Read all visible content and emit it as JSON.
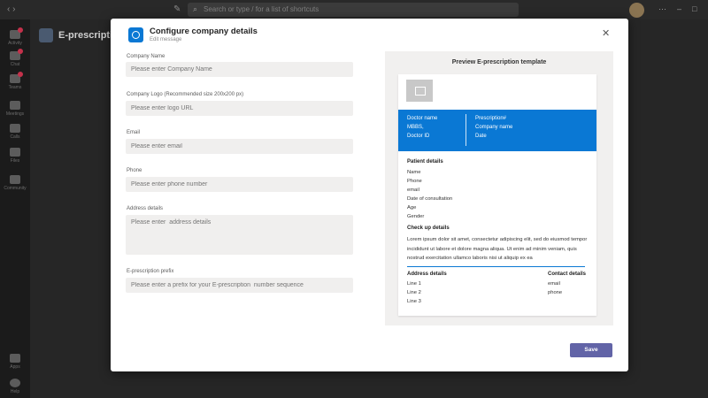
{
  "topbar": {
    "search_placeholder": "Search or type / for a list of shortcuts"
  },
  "rail": {
    "items": [
      {
        "label": "Activity",
        "icon": "bell-icon"
      },
      {
        "label": "Chat",
        "icon": "chat-icon"
      },
      {
        "label": "Teams",
        "icon": "teams-icon"
      },
      {
        "label": "Meetings",
        "icon": "calendar-icon"
      },
      {
        "label": "Calls",
        "icon": "phone-icon"
      },
      {
        "label": "Files",
        "icon": "file-icon"
      },
      {
        "label": "Community",
        "icon": "apps-icon"
      },
      {
        "label": "Apps",
        "icon": "grid-icon"
      },
      {
        "label": "Help",
        "icon": "help-icon"
      }
    ]
  },
  "app": {
    "title": "E-prescription"
  },
  "dialog": {
    "title": "Configure company details",
    "subtitle": "Edit message",
    "fields": {
      "company_name": {
        "label": "Company Name",
        "placeholder": "Please enter Company Name"
      },
      "company_logo": {
        "label": "Company Logo (Recommended size 200x200 px)",
        "placeholder": "Please enter logo URL"
      },
      "email": {
        "label": "Email",
        "placeholder": "Please enter email"
      },
      "phone": {
        "label": "Phone",
        "placeholder": "Please enter phone number"
      },
      "address": {
        "label": "Address details",
        "placeholder": "Please enter  address details"
      },
      "prefix": {
        "label": "E-prescription prefix",
        "placeholder": "Please enter a prefix for your E-prescription  number sequence"
      }
    },
    "save_label": "Save"
  },
  "preview": {
    "title": "Preview E-prescription template",
    "band_left": [
      "Doctor name",
      "MBBS,",
      "Doctor ID"
    ],
    "band_right": [
      "Prescription#",
      "Company name",
      "Date"
    ],
    "patient_heading": "Patient details",
    "patient_fields": [
      "Name",
      "Phone",
      "email",
      "Date of consultation",
      "Age",
      "Gender"
    ],
    "checkup_heading": "Check up details",
    "checkup_text": "Lorem ipsum dolor sit amet, consectetur adipiscing elit, sed do eiusmod tempor incididunt ut labore et dolore magna aliqua. Ut enim ad minim veniam, quis nostrud exercitation ullamco laboris nisi ut aliquip ex ea",
    "address_heading": "Address details",
    "address_lines": [
      "Line 1",
      "Line 2",
      "Line 3"
    ],
    "contact_heading": "Contact details",
    "contact_lines": [
      "email",
      "phone"
    ]
  },
  "colors": {
    "accent": "#0a78d4",
    "save_button": "#6264a7",
    "input_bg": "#f0efee",
    "preview_bg": "#f1f0ef"
  }
}
